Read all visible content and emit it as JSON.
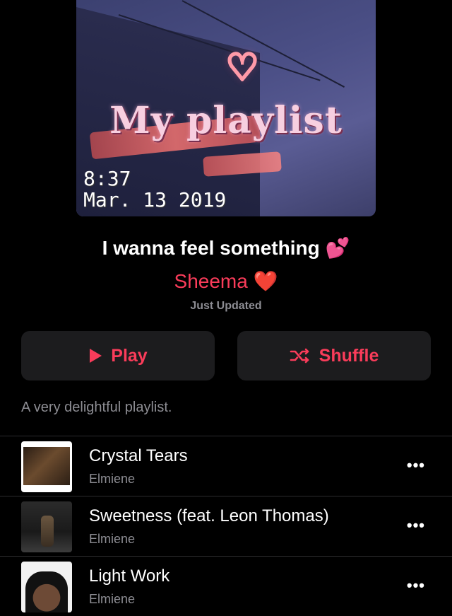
{
  "artwork": {
    "title": "My playlist",
    "stamp_time": "8:37",
    "stamp_date": "Mar. 13 2019"
  },
  "header": {
    "playlist_name": "I wanna feel something 💕",
    "curator": "Sheema ❤️",
    "updated": "Just Updated"
  },
  "actions": {
    "play_label": "Play",
    "shuffle_label": "Shuffle",
    "accent_color": "#fa3c5a"
  },
  "description": "A very delightful playlist.",
  "songs": [
    {
      "title": "Crystal Tears",
      "artist": "Elmiene",
      "more": "•••"
    },
    {
      "title": "Sweetness (feat. Leon Thomas)",
      "artist": "Elmiene",
      "more": "•••"
    },
    {
      "title": "Light Work",
      "artist": "Elmiene",
      "more": "•••"
    }
  ],
  "icons": {
    "play": "play-triangle-icon",
    "shuffle": "shuffle-icon",
    "more": "more-ellipsis-icon"
  }
}
